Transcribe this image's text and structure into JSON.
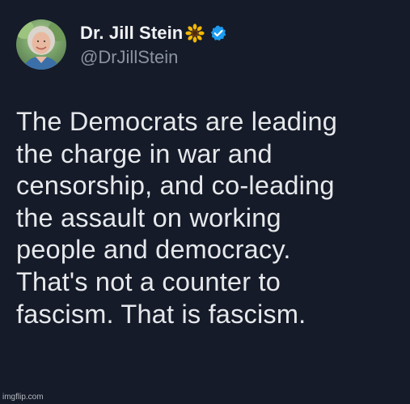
{
  "author": {
    "display_name": "Dr. Jill Stein",
    "handle": "@DrJillStein",
    "name_emoji": "sunflower-icon",
    "verified_icon": "verified-badge-icon",
    "verified_color": "#1d9bf0"
  },
  "tweet": {
    "lines": [
      "The Democrats are leading",
      "the charge in war and",
      "censorship, and co-leading",
      "the assault on working",
      "people and democracy.",
      "That's not a counter to",
      "fascism. That is fascism."
    ]
  },
  "watermark": "imgflip.com",
  "colors": {
    "background": "#151b29",
    "text": "#e6e8eb",
    "handle": "#8b949e"
  }
}
